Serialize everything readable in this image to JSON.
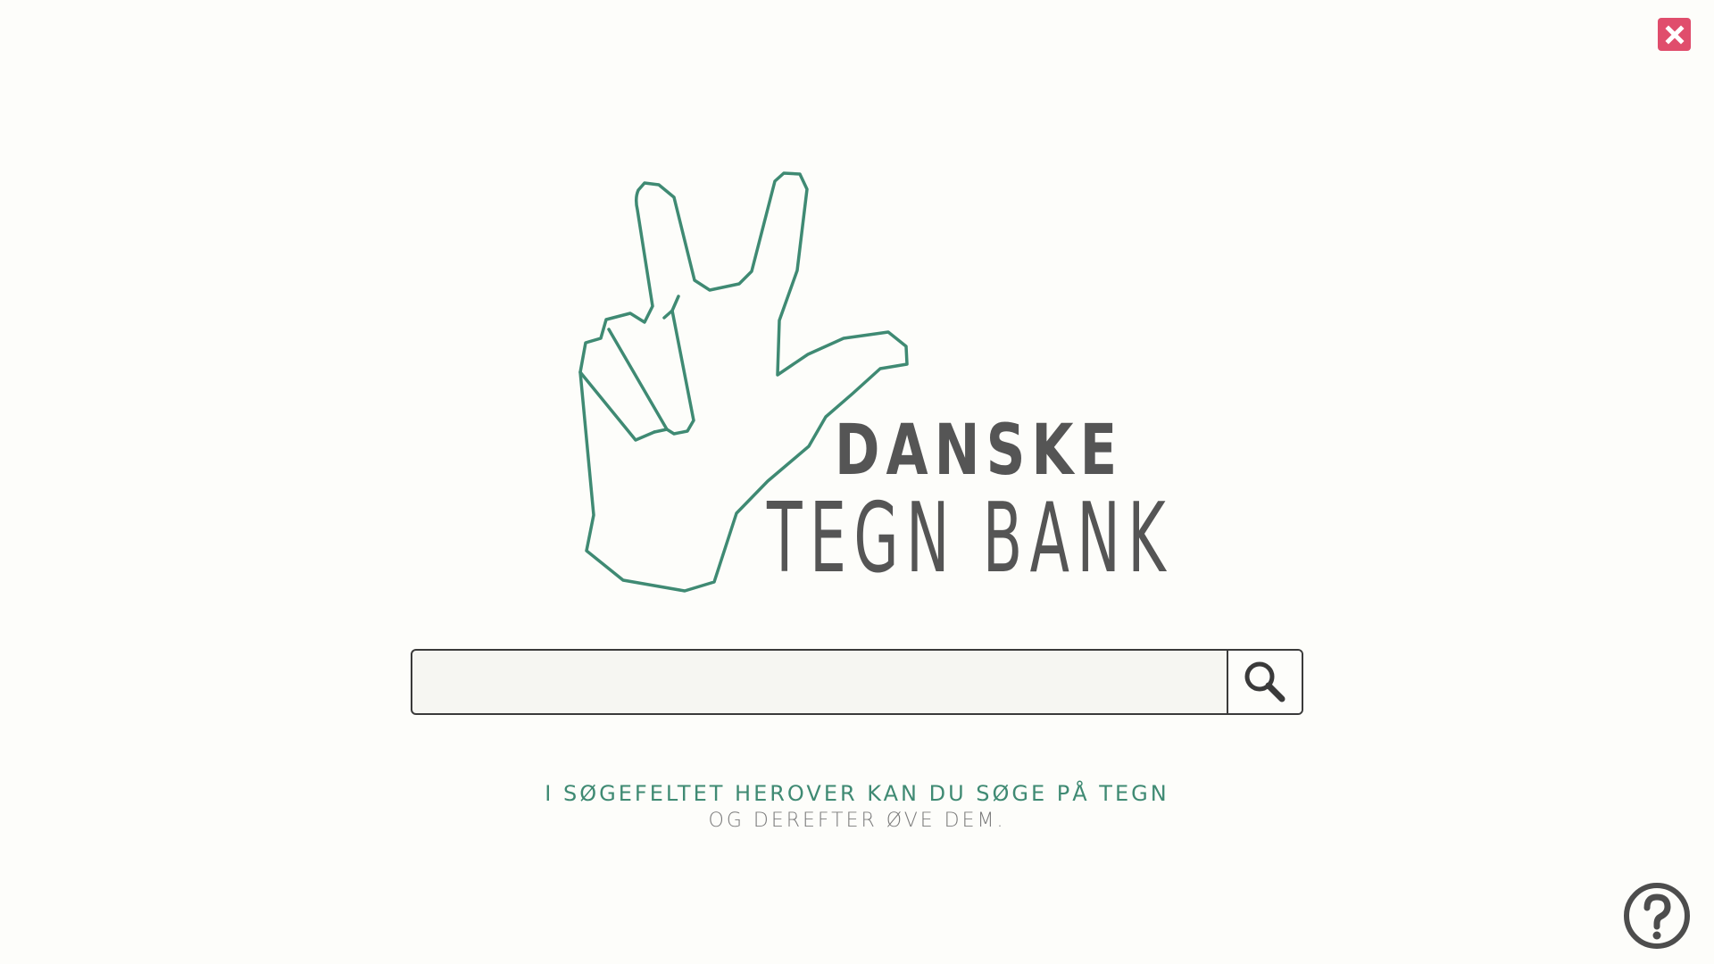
{
  "app": {
    "logo": {
      "word_top": "DANSKE",
      "word_bottom": "TEGN BANK",
      "hand_icon": "hand-three-fingers-icon",
      "hand_color": "#3f8a73",
      "text_color": "#555555"
    }
  },
  "search": {
    "value": "",
    "placeholder": "",
    "button_icon": "search-icon"
  },
  "help_text": {
    "line1": "I SØGEFELTET HEROVER KAN DU SØGE PÅ TEGN",
    "line2": "OG DEREFTER ØVE DEM."
  },
  "controls": {
    "close_icon": "close-icon",
    "close_color": "#e04d6c",
    "help_icon": "help-icon"
  }
}
